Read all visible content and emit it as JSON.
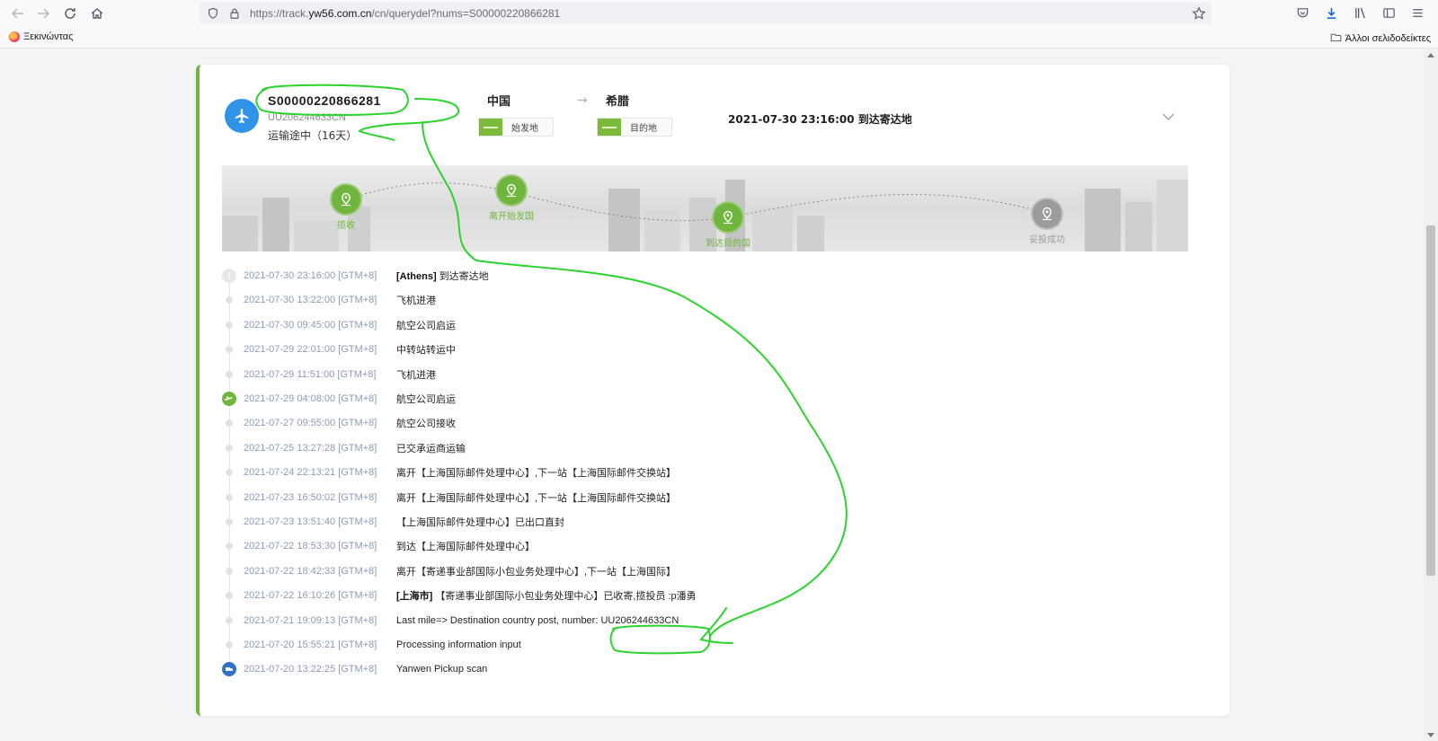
{
  "browser": {
    "url_prefix": "https://track.",
    "url_host": "yw56.com.cn",
    "url_rest": "/cn/querydel?nums=S00000220866281",
    "bookmark_start": "Ξεκινώντας",
    "bookmark_other": "Άλλοι σελιδοδείκτες"
  },
  "shipment": {
    "tracking_number": "S00000220866281",
    "sub_number": "UU206244633CN",
    "status": "运输途中（16天）",
    "origin": "中国",
    "destination": "希腊",
    "origin_tag": "始发地",
    "destination_tag": "目的地",
    "latest_event": "2021-07-30 23:16:00 到达寄达地"
  },
  "milestones": [
    {
      "label": "揽收",
      "done": true
    },
    {
      "label": "离开始发国",
      "done": true
    },
    {
      "label": "到达目的国",
      "done": true
    },
    {
      "label": "妥投成功",
      "done": false
    }
  ],
  "events": [
    {
      "time": "2021-07-30 23:16:00 [GTM+8]",
      "location": "[Athens]",
      "text": "到达寄达地",
      "marker": "warn"
    },
    {
      "time": "2021-07-30 13:22:00 [GTM+8]",
      "location": "",
      "text": "飞机进港",
      "marker": "dot"
    },
    {
      "time": "2021-07-30 09:45:00 [GTM+8]",
      "location": "",
      "text": "航空公司启运",
      "marker": "dot"
    },
    {
      "time": "2021-07-29 22:01:00 [GTM+8]",
      "location": "",
      "text": "中转站转运中",
      "marker": "dot"
    },
    {
      "time": "2021-07-29 11:51:00 [GTM+8]",
      "location": "",
      "text": "飞机进港",
      "marker": "dot"
    },
    {
      "time": "2021-07-29 04:08:00 [GTM+8]",
      "location": "",
      "text": "航空公司启运",
      "marker": "green"
    },
    {
      "time": "2021-07-27 09:55:00 [GTM+8]",
      "location": "",
      "text": "航空公司接收",
      "marker": "dot"
    },
    {
      "time": "2021-07-25 13:27:28 [GTM+8]",
      "location": "",
      "text": "已交承运商运输",
      "marker": "dot"
    },
    {
      "time": "2021-07-24 22:13:21 [GTM+8]",
      "location": "",
      "text": "离开【上海国际邮件处理中心】,下一站【上海国际邮件交换站】",
      "marker": "dot"
    },
    {
      "time": "2021-07-23 16:50:02 [GTM+8]",
      "location": "",
      "text": "离开【上海国际邮件处理中心】,下一站【上海国际邮件交换站】",
      "marker": "dot"
    },
    {
      "time": "2021-07-23 13:51:40 [GTM+8]",
      "location": "",
      "text": "【上海国际邮件处理中心】已出口直封",
      "marker": "dot"
    },
    {
      "time": "2021-07-22 18:53:30 [GTM+8]",
      "location": "",
      "text": "到达【上海国际邮件处理中心】",
      "marker": "dot"
    },
    {
      "time": "2021-07-22 18:42:33 [GTM+8]",
      "location": "",
      "text": "离开【寄递事业部国际小包业务处理中心】,下一站【上海国际】",
      "marker": "dot"
    },
    {
      "time": "2021-07-22 16:10:26 [GTM+8]",
      "location": "[上海市]",
      "text": "【寄递事业部国际小包业务处理中心】已收寄,揽投员 :p潘勇",
      "marker": "dot"
    },
    {
      "time": "2021-07-21 19:09:13 [GTM+8]",
      "location": "",
      "text": "Last mile=> Destination country post, number: UU206244633CN",
      "marker": "dot"
    },
    {
      "time": "2021-07-20 15:55:21 [GTM+8]",
      "location": "",
      "text": "Processing information input",
      "marker": "dot"
    },
    {
      "time": "2021-07-20 13:22:25 [GTM+8]",
      "location": "",
      "text": "Yanwen Pickup scan",
      "marker": "blue"
    }
  ],
  "colors": {
    "accent_green": "#6fb53e",
    "plane_blue": "#2f94e8",
    "annotation_green": "#2bd42b"
  }
}
